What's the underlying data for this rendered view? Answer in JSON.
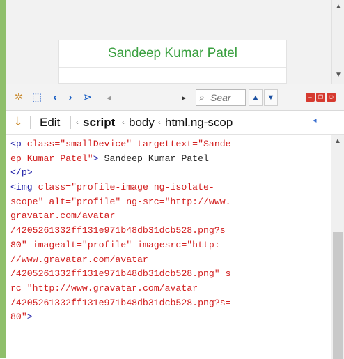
{
  "page": {
    "card_title": "Sandeep Kumar Patel"
  },
  "toolbar": {
    "search_placeholder": "Sear",
    "icons": [
      "pick-icon",
      "inspect-icon",
      "back-icon",
      "forward-icon",
      "indent-icon",
      "scroll-left-icon",
      "scroll-right-icon",
      "search-icon",
      "up-arrow-icon",
      "down-arrow-icon",
      "minimize-icon",
      "restore-icon",
      "close-icon"
    ]
  },
  "breadcrumbs": {
    "edit_label": "Edit",
    "items": [
      "script",
      "body",
      "html.ng-scop"
    ]
  },
  "code_lines": [
    [
      {
        "c": "tag",
        "t": "<p "
      },
      {
        "c": "attr",
        "t": "class="
      },
      {
        "c": "val",
        "t": "\"smallDevice\""
      },
      {
        "c": "attr",
        "t": " targettext="
      },
      {
        "c": "val",
        "t": "\"Sande"
      }
    ],
    [
      {
        "c": "val",
        "t": "ep Kumar Patel\""
      },
      {
        "c": "tag",
        "t": ">"
      },
      {
        "c": "txt",
        "t": " Sandeep Kumar Patel"
      }
    ],
    [
      {
        "c": "tag",
        "t": "</p>"
      }
    ],
    [
      {
        "c": "tag",
        "t": "<img "
      },
      {
        "c": "attr",
        "t": "class="
      },
      {
        "c": "val",
        "t": "\"profile-image ng-isolate-"
      }
    ],
    [
      {
        "c": "val",
        "t": "scope\""
      },
      {
        "c": "attr",
        "t": " alt="
      },
      {
        "c": "val",
        "t": "\"profile\""
      },
      {
        "c": "attr",
        "t": " ng-src="
      },
      {
        "c": "val",
        "t": "\"http://www."
      }
    ],
    [
      {
        "c": "val",
        "t": "gravatar.com/avatar"
      }
    ],
    [
      {
        "c": "val",
        "t": "/4205261332ff131e971b48db31dcb528.png?s="
      }
    ],
    [
      {
        "c": "val",
        "t": "80\""
      },
      {
        "c": "attr",
        "t": " imagealt="
      },
      {
        "c": "val",
        "t": "\"profile\""
      },
      {
        "c": "attr",
        "t": " imagesrc="
      },
      {
        "c": "val",
        "t": "\"http:"
      }
    ],
    [
      {
        "c": "val",
        "t": "//www.gravatar.com/avatar"
      }
    ],
    [
      {
        "c": "val",
        "t": "/4205261332ff131e971b48db31dcb528.png\""
      },
      {
        "c": "attr",
        "t": " s"
      }
    ],
    [
      {
        "c": "attr",
        "t": "rc="
      },
      {
        "c": "val",
        "t": "\"http://www.gravatar.com/avatar"
      }
    ],
    [
      {
        "c": "val",
        "t": "/4205261332ff131e971b48db31dcb528.png?s="
      }
    ],
    [
      {
        "c": "val",
        "t": "80\""
      },
      {
        "c": "tag",
        "t": ">"
      }
    ]
  ]
}
